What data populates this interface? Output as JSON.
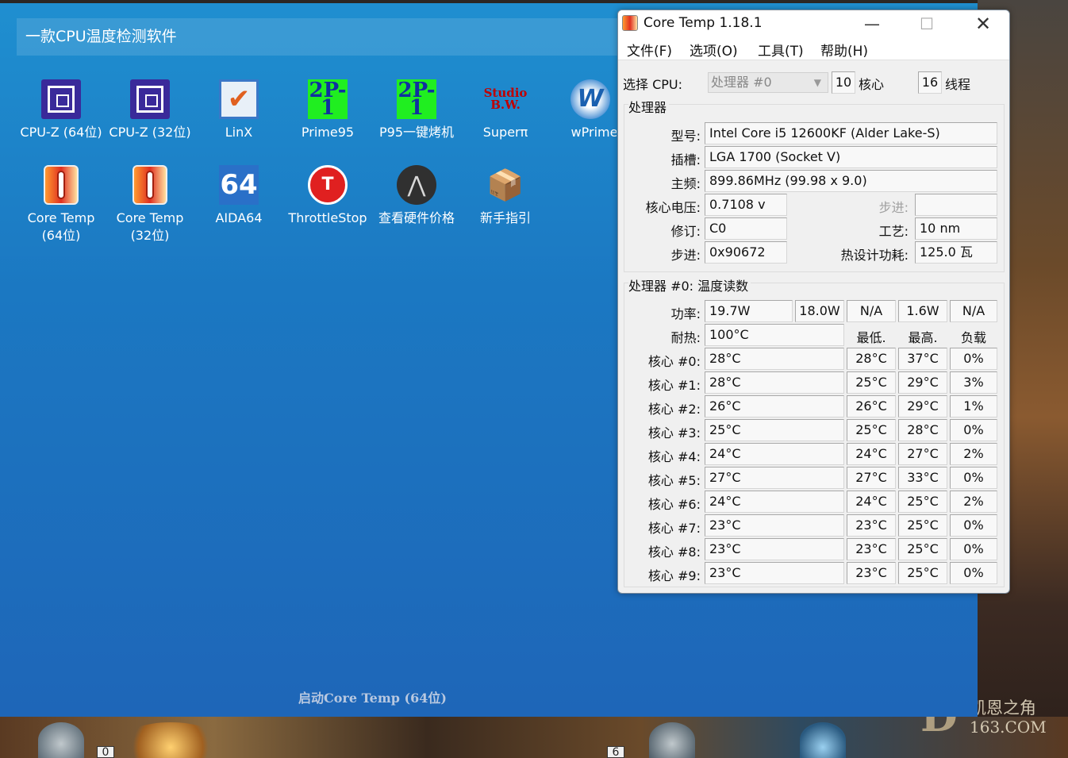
{
  "launcher": {
    "title": "一款CPU温度检测软件",
    "start_label": "启动Core Temp (64位)",
    "apps_row1": [
      {
        "label": "CPU-Z (64位)",
        "icon": "cpu-chip-icon"
      },
      {
        "label": "CPU-Z (32位)",
        "icon": "cpu-chip-icon"
      },
      {
        "label": "LinX",
        "icon": "checkmark-icon"
      },
      {
        "label": "Prime95",
        "icon": "prime-formula-icon",
        "icon_text": "2P-1"
      },
      {
        "label": "P95一键烤机",
        "icon": "prime-formula-icon",
        "icon_text": "2P-1"
      },
      {
        "label": "Superπ",
        "icon": "superpi-logo-icon",
        "icon_text": "Studio B.W."
      },
      {
        "label": "wPrime",
        "icon": "wprime-logo-icon",
        "icon_text": "W"
      }
    ],
    "apps_row2": [
      {
        "label": "Core Temp",
        "sub": "(64位)",
        "icon": "thermometer-icon"
      },
      {
        "label": "Core Temp",
        "sub": "(32位)",
        "icon": "thermometer-icon"
      },
      {
        "label": "AIDA64",
        "icon": "aida64-logo-icon",
        "icon_text": "64"
      },
      {
        "label": "ThrottleStop",
        "icon": "stop-sign-icon",
        "icon_text": "T"
      },
      {
        "label": "查看硬件价格",
        "icon": "price-logo-icon"
      },
      {
        "label": "新手指引",
        "icon": "package-icon"
      }
    ]
  },
  "background": {
    "watermark_letter": "D",
    "watermark_line1": "凯恩之角",
    "watermark_line2": "163.COM",
    "taskbar_numbers": [
      "0",
      "6"
    ]
  },
  "window": {
    "title": "Core Temp 1.18.1",
    "controls": {
      "minimize": "—",
      "maximize": "☐",
      "close": "✕"
    },
    "menu": [
      "文件(F)",
      "选项(O)",
      "工具(T)",
      "帮助(H)"
    ],
    "select_cpu_label": "选择 CPU:",
    "select_cpu_value": "处理器 #0",
    "cores_value": "10",
    "cores_label": "核心",
    "threads_value": "16",
    "threads_label": "线程",
    "processor_group": "处理器",
    "fields": {
      "model_label": "型号:",
      "model": "Intel Core i5 12600KF (Alder Lake-S)",
      "socket_label": "插槽:",
      "socket": "LGA 1700 (Socket V)",
      "freq_label": "主频:",
      "freq": "899.86MHz (99.98 x 9.0)",
      "vid_label": "核心电压:",
      "vid": "0.7108 v",
      "stepping_label_gray": "步进:",
      "stepping_gray": "",
      "revision_label": "修订:",
      "revision": "C0",
      "lithography_label": "工艺:",
      "lithography": "10 nm",
      "cpuid_label": "步进:",
      "cpuid": "0x90672",
      "tdp_label": "热设计功耗:",
      "tdp": "125.0 瓦"
    },
    "temp_group": "处理器 #0: 温度读数",
    "power_label": "功率:",
    "power": [
      "19.7W",
      "18.0W",
      "N/A",
      "1.6W",
      "N/A"
    ],
    "tjmax_label": "耐热:",
    "tjmax": "100°C",
    "col_min": "最低.",
    "col_max": "最高.",
    "col_load": "负载",
    "cores": [
      {
        "label": "核心 #0:",
        "temp": "28°C",
        "min": "28°C",
        "max": "37°C",
        "load": "0%"
      },
      {
        "label": "核心 #1:",
        "temp": "28°C",
        "min": "25°C",
        "max": "29°C",
        "load": "3%"
      },
      {
        "label": "核心 #2:",
        "temp": "26°C",
        "min": "26°C",
        "max": "29°C",
        "load": "1%"
      },
      {
        "label": "核心 #3:",
        "temp": "25°C",
        "min": "25°C",
        "max": "28°C",
        "load": "0%"
      },
      {
        "label": "核心 #4:",
        "temp": "24°C",
        "min": "24°C",
        "max": "27°C",
        "load": "2%"
      },
      {
        "label": "核心 #5:",
        "temp": "27°C",
        "min": "27°C",
        "max": "33°C",
        "load": "0%"
      },
      {
        "label": "核心 #6:",
        "temp": "24°C",
        "min": "24°C",
        "max": "25°C",
        "load": "2%"
      },
      {
        "label": "核心 #7:",
        "temp": "23°C",
        "min": "23°C",
        "max": "25°C",
        "load": "0%"
      },
      {
        "label": "核心 #8:",
        "temp": "23°C",
        "min": "23°C",
        "max": "25°C",
        "load": "0%"
      },
      {
        "label": "核心 #9:",
        "temp": "23°C",
        "min": "23°C",
        "max": "25°C",
        "load": "0%"
      }
    ]
  }
}
